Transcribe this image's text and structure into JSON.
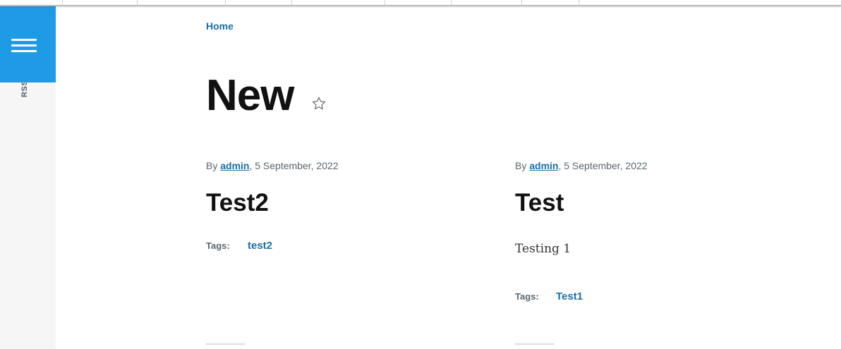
{
  "sidebar": {
    "rss_label": "RSS"
  },
  "breadcrumb": {
    "home": "Home"
  },
  "page": {
    "title": "New"
  },
  "articles": [
    {
      "by_prefix": "By",
      "author": "admin",
      "date": ", 5 September, 2022",
      "title": "Test2",
      "body": "",
      "tags_label": "Tags:",
      "tags": [
        "test2"
      ]
    },
    {
      "by_prefix": "By",
      "author": "admin",
      "date": ", 5 September, 2022",
      "title": "Test",
      "body": "Testing 1",
      "tags_label": "Tags:",
      "tags": [
        "Test1"
      ]
    }
  ],
  "icons": {
    "menu": "hamburger-menu-icon",
    "bookmark": "star-outline-icon"
  },
  "colors": {
    "accent": "#1f9ae5",
    "link": "#1c6ea4",
    "sidebar_bg": "#f5f6f5",
    "meta_text": "#5b6670"
  }
}
